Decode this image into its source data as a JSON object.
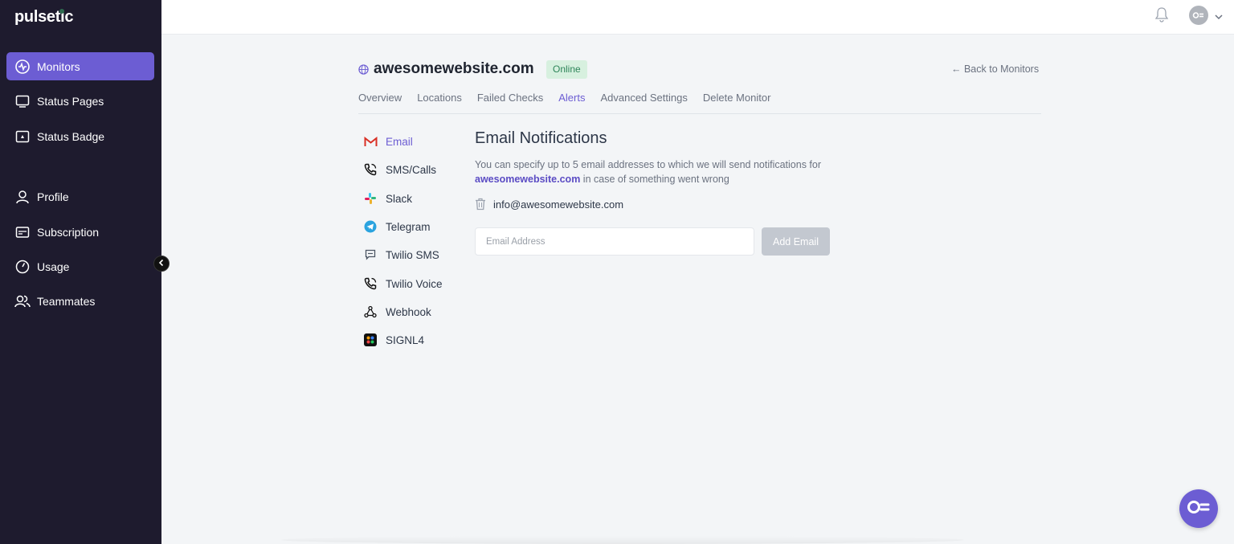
{
  "app": {
    "logo": "pulsetic"
  },
  "sidebar": {
    "items": [
      {
        "label": "Monitors",
        "icon": "monitors-icon",
        "active": true
      },
      {
        "label": "Status Pages",
        "icon": "status-pages-icon"
      },
      {
        "label": "Status Badge",
        "icon": "status-badge-icon"
      },
      {
        "label": "Profile",
        "icon": "profile-icon"
      },
      {
        "label": "Subscription",
        "icon": "subscription-icon"
      },
      {
        "label": "Usage",
        "icon": "usage-icon"
      },
      {
        "label": "Teammates",
        "icon": "teammates-icon"
      }
    ]
  },
  "header": {
    "site": "awesomewebsite.com",
    "status": "Online",
    "back_link": "← Back to Monitors"
  },
  "tabs": [
    {
      "label": "Overview"
    },
    {
      "label": "Locations"
    },
    {
      "label": "Failed Checks"
    },
    {
      "label": "Alerts",
      "active": true
    },
    {
      "label": "Advanced Settings"
    },
    {
      "label": "Delete Monitor"
    }
  ],
  "channels": [
    {
      "label": "Email",
      "icon": "gmail-icon",
      "active": true
    },
    {
      "label": "SMS/Calls",
      "icon": "phone-icon"
    },
    {
      "label": "Slack",
      "icon": "slack-icon"
    },
    {
      "label": "Telegram",
      "icon": "telegram-icon"
    },
    {
      "label": "Twilio SMS",
      "icon": "chat-bubble-icon"
    },
    {
      "label": "Twilio Voice",
      "icon": "phone-icon"
    },
    {
      "label": "Webhook",
      "icon": "webhook-icon"
    },
    {
      "label": "SIGNL4",
      "icon": "signl4-icon"
    }
  ],
  "email_panel": {
    "title": "Email Notifications",
    "desc_before": "You can specify up to 5 email addresses to which we will send notifications for ",
    "desc_link": "awesomewebsite.com",
    "desc_after": " in case of something went wrong",
    "existing_email": "info@awesomewebsite.com",
    "input_placeholder": "Email Address",
    "add_button": "Add Email"
  },
  "colors": {
    "sidebar_bg": "#1e1b2e",
    "accent": "#6c5dd3",
    "online_bg": "#d7f0df",
    "online_text": "#2f855a"
  }
}
